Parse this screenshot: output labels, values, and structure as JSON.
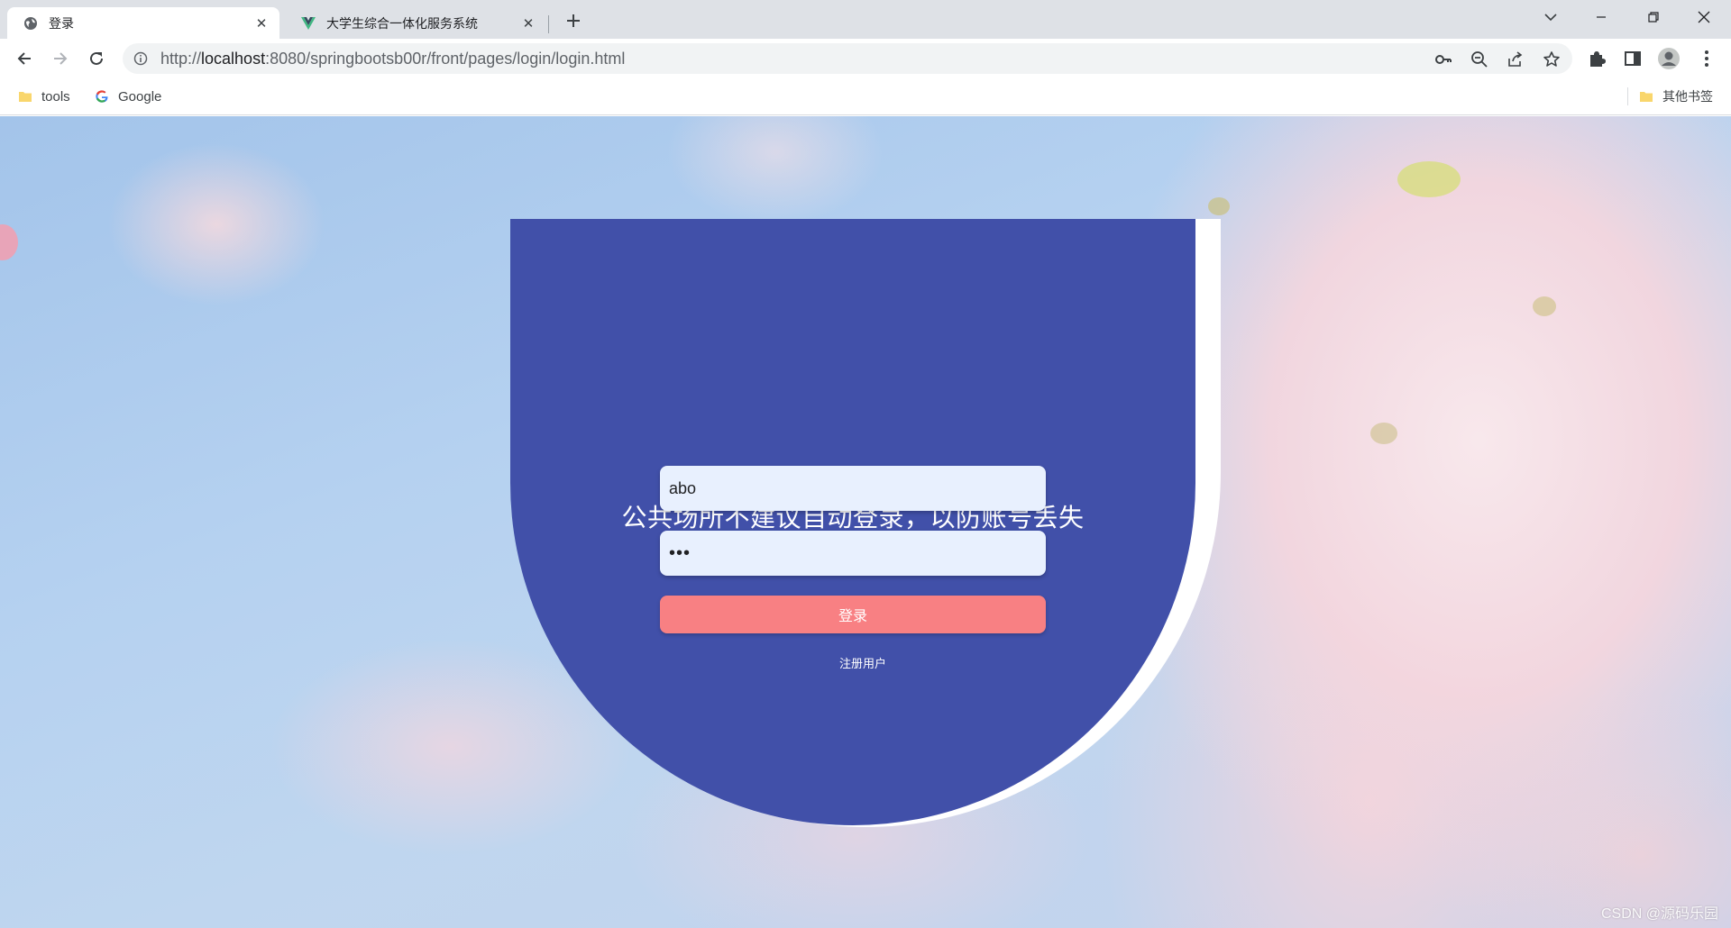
{
  "browser": {
    "tabs": [
      {
        "title": "登录",
        "active": true,
        "favicon": "globe-icon"
      },
      {
        "title": "大学生综合一体化服务系统",
        "active": false,
        "favicon": "vue-logo-icon"
      }
    ],
    "url": {
      "scheme": "http://",
      "host": "localhost",
      "rest": ":8080/springbootsb00r/front/pages/login/login.html"
    },
    "bookmarks": [
      {
        "label": "tools",
        "icon": "folder-icon"
      },
      {
        "label": "Google",
        "icon": "google-icon"
      }
    ],
    "other_bookmarks": "其他书签"
  },
  "login": {
    "title": "公共场所不建议自动登录，以防账号丢失",
    "username_value": "abo",
    "password_value": "•••",
    "submit_label": "登录",
    "register_label": "注册用户"
  },
  "watermark": "CSDN @源码乐园",
  "colors": {
    "card": "#4150a9",
    "button": "#f88083",
    "input_bg": "#e8f0fe"
  }
}
